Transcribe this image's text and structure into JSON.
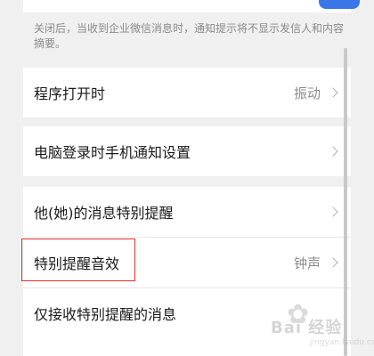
{
  "top_toggle": {
    "state": "on",
    "color": "#3a76e8"
  },
  "note": "关闭后，当收到企业微信消息时，通知提示将不显示发信人和内容摘要。",
  "rows": [
    {
      "label": "程序打开时",
      "value": "振动"
    },
    {
      "label": "电脑登录时手机通知设置",
      "value": ""
    },
    {
      "label": "他(她)的消息特别提醒",
      "value": ""
    },
    {
      "label": "特别提醒音效",
      "value": "钟声"
    },
    {
      "label": "仅接收特别提醒的消息",
      "value": ""
    }
  ],
  "highlight_color": "#e03030",
  "watermark": {
    "text": "Bai 经验",
    "sub": "jingyan.baidu.com",
    "icon": "paw-icon"
  }
}
